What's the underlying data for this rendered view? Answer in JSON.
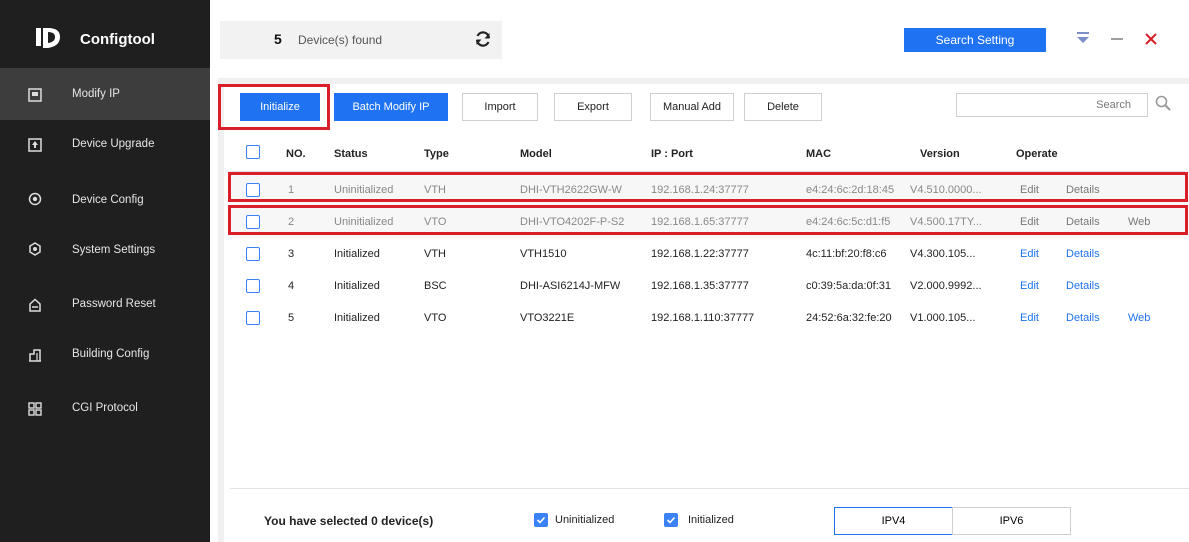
{
  "app": {
    "title": "Configtool"
  },
  "sidebar": {
    "items": [
      {
        "label": "Modify IP",
        "icon": "ip-icon",
        "active": true
      },
      {
        "label": "Device Upgrade",
        "icon": "upgrade-icon",
        "active": false
      },
      {
        "label": "Device Config",
        "icon": "config-icon",
        "active": false
      },
      {
        "label": "System Settings",
        "icon": "settings-icon",
        "active": false
      },
      {
        "label": "Password Reset",
        "icon": "lock-icon",
        "active": false
      },
      {
        "label": "Building Config",
        "icon": "building-icon",
        "active": false
      },
      {
        "label": "CGI Protocol",
        "icon": "cgi-icon",
        "active": false
      }
    ]
  },
  "header": {
    "device_count": "5",
    "device_label": "Device(s) found",
    "search_setting_label": "Search Setting"
  },
  "toolbar": {
    "initialize": "Initialize",
    "batch_modify": "Batch Modify IP",
    "import": "Import",
    "export": "Export",
    "manual_add": "Manual Add",
    "delete": "Delete",
    "search_placeholder": "Search"
  },
  "table": {
    "columns": [
      "NO.",
      "Status",
      "Type",
      "Model",
      "IP : Port",
      "MAC",
      "Version",
      "Operate"
    ],
    "rows": [
      {
        "no": "1",
        "status": "Uninitialized",
        "type": "VTH",
        "model": "DHI-VTH2622GW-W",
        "ip": "192.168.1.24:37777",
        "mac": "e4:24:6c:2d:18:45",
        "version": "V4.510.0000...",
        "edit": "Edit",
        "details": "Details",
        "web": ""
      },
      {
        "no": "2",
        "status": "Uninitialized",
        "type": "VTO",
        "model": "DHI-VTO4202F-P-S2",
        "ip": "192.168.1.65:37777",
        "mac": "e4:24:6c:5c:d1:f5",
        "version": "V4.500.17TY...",
        "edit": "Edit",
        "details": "Details",
        "web": "Web"
      },
      {
        "no": "3",
        "status": "Initialized",
        "type": "VTH",
        "model": "VTH1510",
        "ip": "192.168.1.22:37777",
        "mac": "4c:11:bf:20:f8:c6",
        "version": "V4.300.105...",
        "edit": "Edit",
        "details": "Details",
        "web": ""
      },
      {
        "no": "4",
        "status": "Initialized",
        "type": "BSC",
        "model": "DHI-ASI6214J-MFW",
        "ip": "192.168.1.35:37777",
        "mac": "c0:39:5a:da:0f:31",
        "version": "V2.000.9992...",
        "edit": "Edit",
        "details": "Details",
        "web": ""
      },
      {
        "no": "5",
        "status": "Initialized",
        "type": "VTO",
        "model": "VTO3221E",
        "ip": "192.168.1.110:37777",
        "mac": "24:52:6a:32:fe:20",
        "version": "V1.000.105...",
        "edit": "Edit",
        "details": "Details",
        "web": "Web"
      }
    ]
  },
  "footer": {
    "selected_text": "You have selected 0 device(s)",
    "filter_uninitialized": "Uninitialized",
    "filter_initialized": "Initialized",
    "ipv4": "IPV4",
    "ipv6": "IPV6"
  },
  "colors": {
    "accent": "#1f72f2",
    "sidebar_bg": "#1f1f1f",
    "highlight_red": "#d9202a"
  }
}
